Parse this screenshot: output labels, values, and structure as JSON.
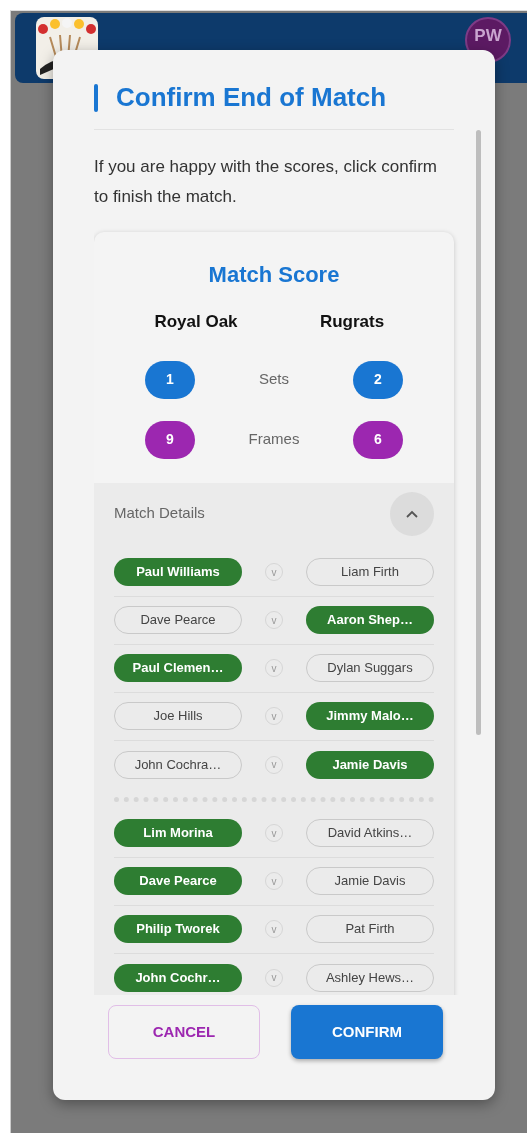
{
  "header": {
    "avatar": "PW"
  },
  "dialog": {
    "title": "Confirm End of Match",
    "message": "If you are happy with the scores, click confirm to finish the match.",
    "score": {
      "title": "Match Score",
      "home_team": "Royal Oak",
      "away_team": "Rugrats",
      "rows": [
        {
          "label": "Sets",
          "home": "1",
          "away": "2",
          "color": "#1976d2"
        },
        {
          "label": "Frames",
          "home": "9",
          "away": "6",
          "color": "#9c27b0"
        }
      ]
    },
    "details": {
      "title": "Match Details",
      "expanded": true,
      "groups": [
        {
          "frames": [
            {
              "home": {
                "name": "Paul Williams",
                "won": true
              },
              "versus": "v",
              "away": {
                "name": "Liam Firth",
                "won": false
              }
            },
            {
              "home": {
                "name": "Dave Pearce",
                "won": false
              },
              "versus": "v",
              "away": {
                "name": "Aaron Shep…",
                "won": true
              }
            },
            {
              "home": {
                "name": "Paul Clemen…",
                "won": true
              },
              "versus": "v",
              "away": {
                "name": "Dylan Suggars",
                "won": false
              }
            },
            {
              "home": {
                "name": "Joe Hills",
                "won": false
              },
              "versus": "v",
              "away": {
                "name": "Jimmy Malo…",
                "won": true
              }
            },
            {
              "home": {
                "name": "John Cochra…",
                "won": false
              },
              "versus": "v",
              "away": {
                "name": "Jamie Davis",
                "won": true
              }
            }
          ]
        },
        {
          "frames": [
            {
              "home": {
                "name": "Lim Morina",
                "won": true
              },
              "versus": "v",
              "away": {
                "name": "David Atkins…",
                "won": false
              }
            },
            {
              "home": {
                "name": "Dave Pearce",
                "won": true
              },
              "versus": "v",
              "away": {
                "name": "Jamie Davis",
                "won": false
              }
            },
            {
              "home": {
                "name": "Philip Tworek",
                "won": true
              },
              "versus": "v",
              "away": {
                "name": "Pat Firth",
                "won": false
              }
            },
            {
              "home": {
                "name": "John Cochr…",
                "won": true
              },
              "versus": "v",
              "away": {
                "name": "Ashley Hews…",
                "won": false
              }
            }
          ]
        }
      ]
    },
    "buttons": [
      {
        "label": "CANCEL",
        "kind": "secondary"
      },
      {
        "label": "CONFIRM",
        "kind": "primary"
      }
    ]
  }
}
